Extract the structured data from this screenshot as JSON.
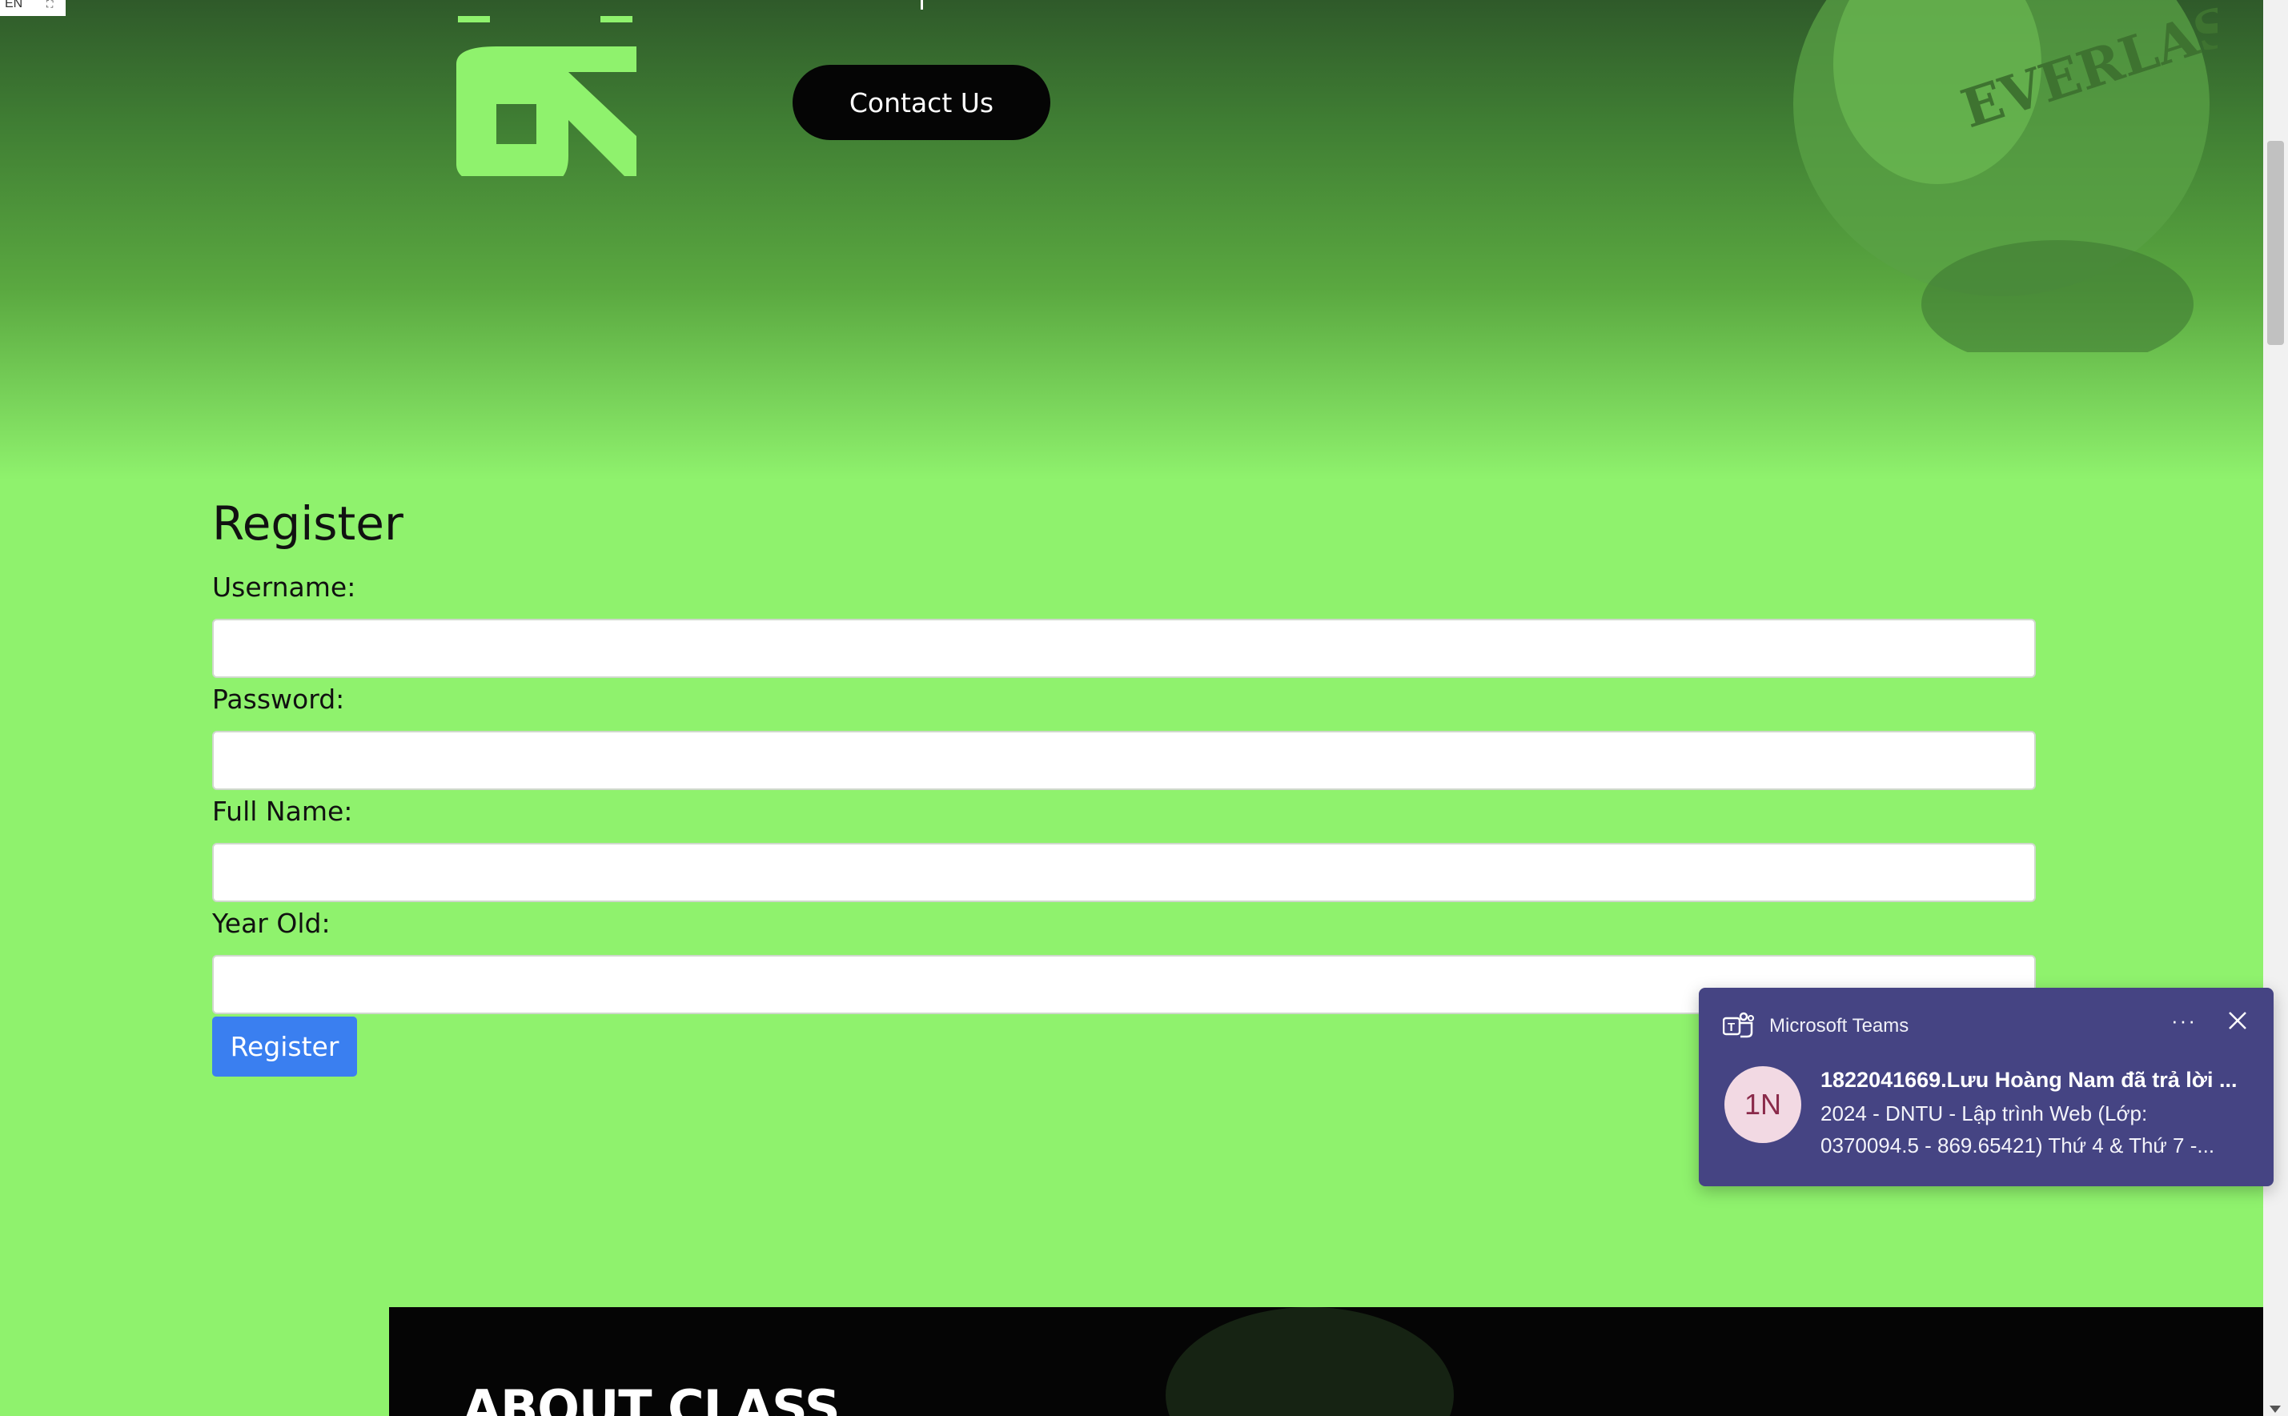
{
  "language_indicator": {
    "code": "EN",
    "icon": "expand-icon"
  },
  "hero": {
    "contact_button": "Contact Us",
    "glove_text": "EVERLAST."
  },
  "register_form": {
    "title": "Register",
    "fields": [
      {
        "label": "Username:",
        "value": "",
        "placeholder": ""
      },
      {
        "label": "Password:",
        "value": "",
        "placeholder": ""
      },
      {
        "label": "Full Name:",
        "value": "",
        "placeholder": ""
      },
      {
        "label": "Year Old:",
        "value": "",
        "placeholder": ""
      }
    ],
    "submit_label": "Register"
  },
  "about_section": {
    "title": "ABOUT CLASS"
  },
  "notification": {
    "app_name": "Microsoft Teams",
    "app_icon": "teams-icon",
    "more_icon": "more-dots-icon",
    "close_icon": "close-icon",
    "avatar_initials": "1N",
    "sender_line": "1822041669.Lưu Hoàng Nam đã trả lời ...",
    "message_line_1": "2024 - DNTU - Lập trình Web (Lớp:",
    "message_line_2": "0370094.5 - 869.65421) Thứ 4 & Thứ 7 -..."
  },
  "colors": {
    "page_background": "#8ff26d",
    "contact_button_bg": "#050505",
    "register_button_bg": "#3a7ff0",
    "toast_bg": "#454483",
    "about_bg": "#050505"
  }
}
